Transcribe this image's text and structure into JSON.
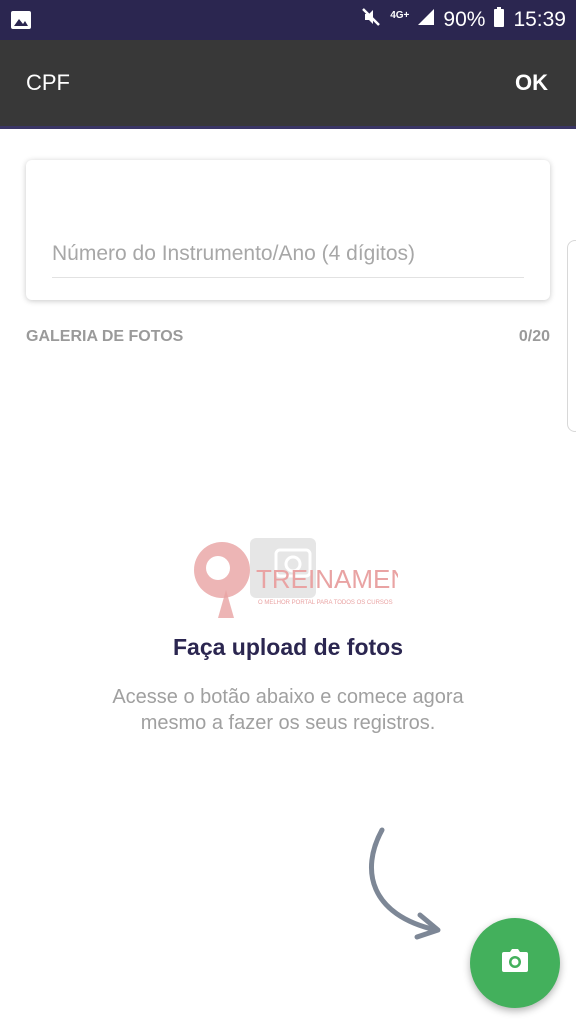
{
  "status_bar": {
    "gallery_icon": "image-icon",
    "mute_icon": "vibrate-mute-icon",
    "network": "4G+",
    "battery_percent": "90%",
    "time": "15:39"
  },
  "app_bar": {
    "title": "CPF",
    "action": "OK"
  },
  "form": {
    "placeholder": "Número do Instrumento/Ano (4 dígitos)"
  },
  "gallery": {
    "label": "GALERIA DE FOTOS",
    "count": "0/20"
  },
  "watermark": {
    "text": "TREINAMENTOS",
    "tagline": "O MELHOR PORTAL PARA TODOS OS CURSOS"
  },
  "empty_state": {
    "title": "Faça upload de fotos",
    "description": "Acesse o botão abaixo e comece agora mesmo a fazer os seus registros."
  },
  "fab": {
    "icon": "camera-icon"
  },
  "colors": {
    "status_bar": "#2b2650",
    "app_bar": "#383838",
    "accent_green": "#43b05c",
    "title_dark": "#2b2650"
  }
}
